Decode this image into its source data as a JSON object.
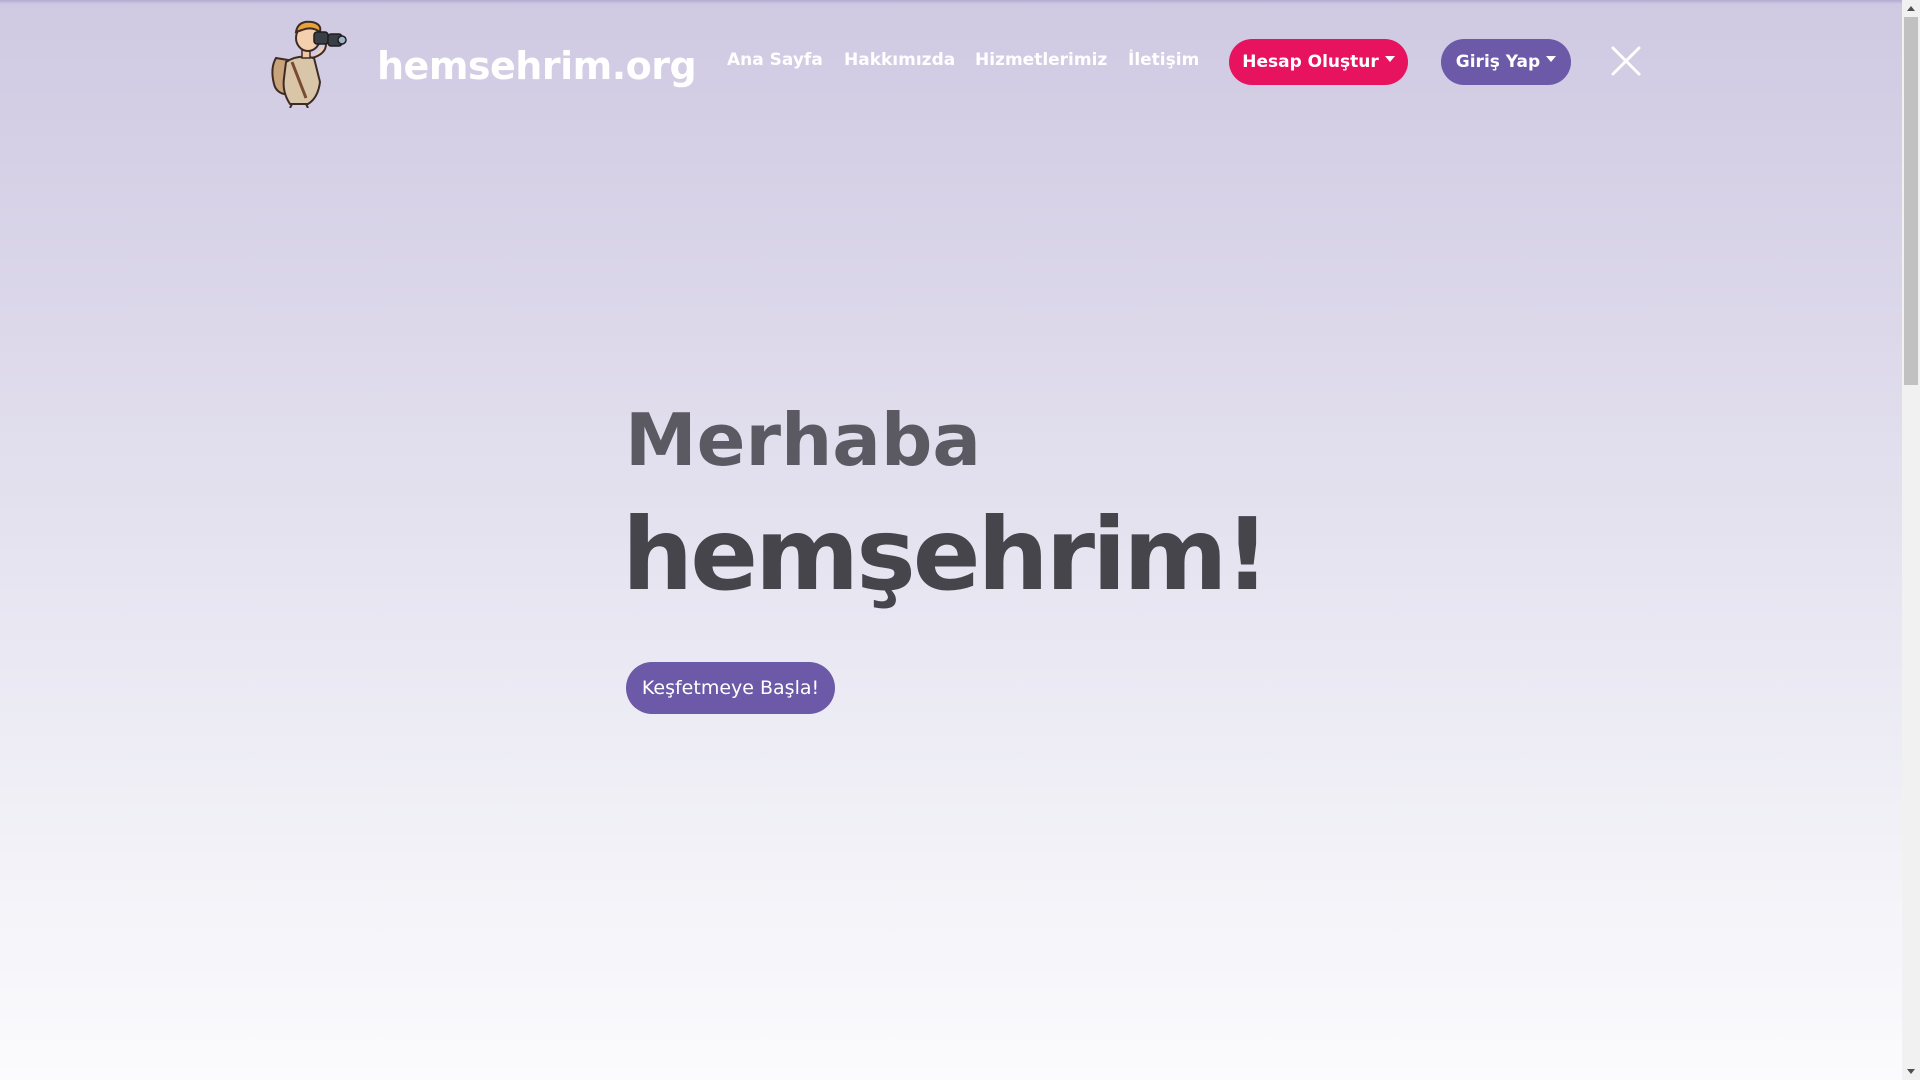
{
  "brand": {
    "name": "hemsehrim.org",
    "logo_icon": "binoculars-explorer-mascot-icon"
  },
  "nav": {
    "links": [
      {
        "label": "Ana Sayfa"
      },
      {
        "label": "Hakkımızda"
      },
      {
        "label": "Hizmetlerimiz"
      },
      {
        "label": "İletişim"
      }
    ],
    "signup_button": {
      "label": "Hesap Oluştur",
      "color": "#e8135f"
    },
    "login_button": {
      "label": "Giriş Yap",
      "color": "#6c59a8"
    },
    "close_icon": "close-icon"
  },
  "hero": {
    "greeting": "Merhaba",
    "headline": "hemşehrim!",
    "cta_label": "Keşfetmeye Başla!",
    "cta_color": "#6c59a8"
  },
  "colors": {
    "background_top": "#cfc9e2",
    "background_bottom": "#fbfbfd",
    "text_dark": "#46454c"
  }
}
